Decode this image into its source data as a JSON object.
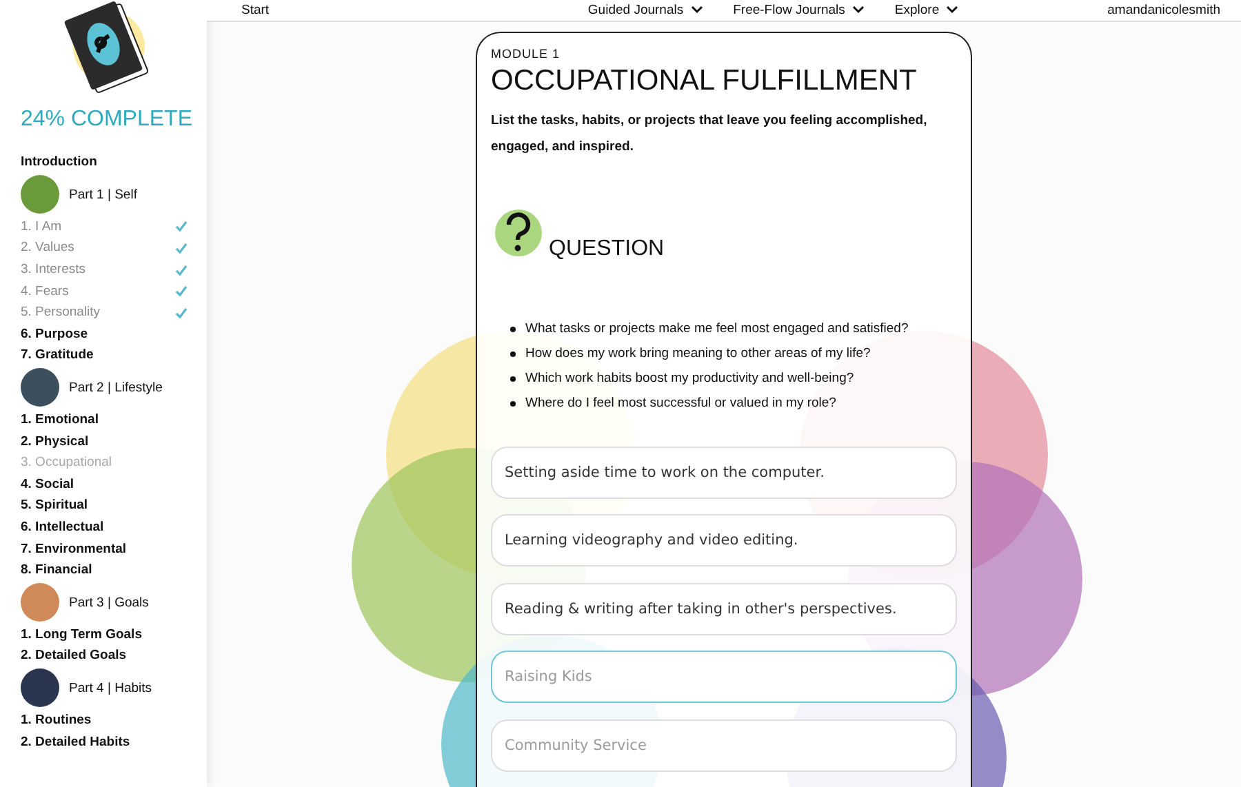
{
  "sidebar": {
    "progress": "24% COMPLETE",
    "intro": "Introduction",
    "parts": [
      {
        "title": "Part 1 | Self",
        "color": "#6a9a3a",
        "items": [
          {
            "label": "1. I Am",
            "completed": true,
            "selected": false
          },
          {
            "label": "2. Values",
            "completed": true,
            "selected": false
          },
          {
            "label": "3. Interests",
            "completed": true,
            "selected": false
          },
          {
            "label": "4. Fears",
            "completed": true,
            "selected": false
          },
          {
            "label": "5. Personality",
            "completed": true,
            "selected": false
          },
          {
            "label": "6. Purpose",
            "completed": false,
            "selected": false
          },
          {
            "label": "7. Gratitude",
            "completed": false,
            "selected": false
          }
        ]
      },
      {
        "title": "Part 2 | Lifestyle",
        "color": "#3b4f5c",
        "items": [
          {
            "label": "1. Emotional",
            "completed": false,
            "selected": false
          },
          {
            "label": "2. Physical",
            "completed": false,
            "selected": false
          },
          {
            "label": "3. Occupational",
            "completed": false,
            "selected": true
          },
          {
            "label": "4. Social",
            "completed": false,
            "selected": false
          },
          {
            "label": "5. Spiritual",
            "completed": false,
            "selected": false
          },
          {
            "label": "6. Intellectual",
            "completed": false,
            "selected": false
          },
          {
            "label": "7. Environmental",
            "completed": false,
            "selected": false
          },
          {
            "label": "8. Financial",
            "completed": false,
            "selected": false
          }
        ]
      },
      {
        "title": "Part 3 | Goals",
        "color": "#d08a5a",
        "items": [
          {
            "label": "1. Long Term Goals",
            "completed": false,
            "selected": false
          },
          {
            "label": "2. Detailed Goals",
            "completed": false,
            "selected": false
          }
        ]
      },
      {
        "title": "Part 4 | Habits",
        "color": "#2a3550",
        "items": [
          {
            "label": "1. Routines",
            "completed": false,
            "selected": false
          },
          {
            "label": "2. Detailed Habits",
            "completed": false,
            "selected": false
          }
        ]
      }
    ]
  },
  "nav": {
    "start": "Start",
    "menus": [
      "Guided Journals",
      "Free-Flow Journals",
      "Explore"
    ],
    "user": "amandanicolesmith"
  },
  "module": {
    "eyebrow": "MODULE 1",
    "title": "OCCUPATIONAL FULFILLMENT",
    "intro": "List the tasks, habits, or projects that leave you feeling accomplished, engaged, and inspired.",
    "question_heading": "QUESTION",
    "questions": [
      "What tasks or projects make me feel most engaged and satisfied?",
      "How does my work bring meaning to other areas of my life?",
      "Which work habits boost my productivity and well-being?",
      "Where do I feel most successful or valued in my role?"
    ],
    "answers": [
      {
        "value": "Setting aside time to work on the computer.",
        "focused": false
      },
      {
        "value": "Learning videography and video editing.",
        "focused": false
      },
      {
        "value": "Reading & writing after taking in other's perspectives.",
        "focused": false
      },
      {
        "placeholder": "Raising Kids",
        "focused": true
      },
      {
        "placeholder": "Community Service",
        "focused": false
      }
    ]
  }
}
